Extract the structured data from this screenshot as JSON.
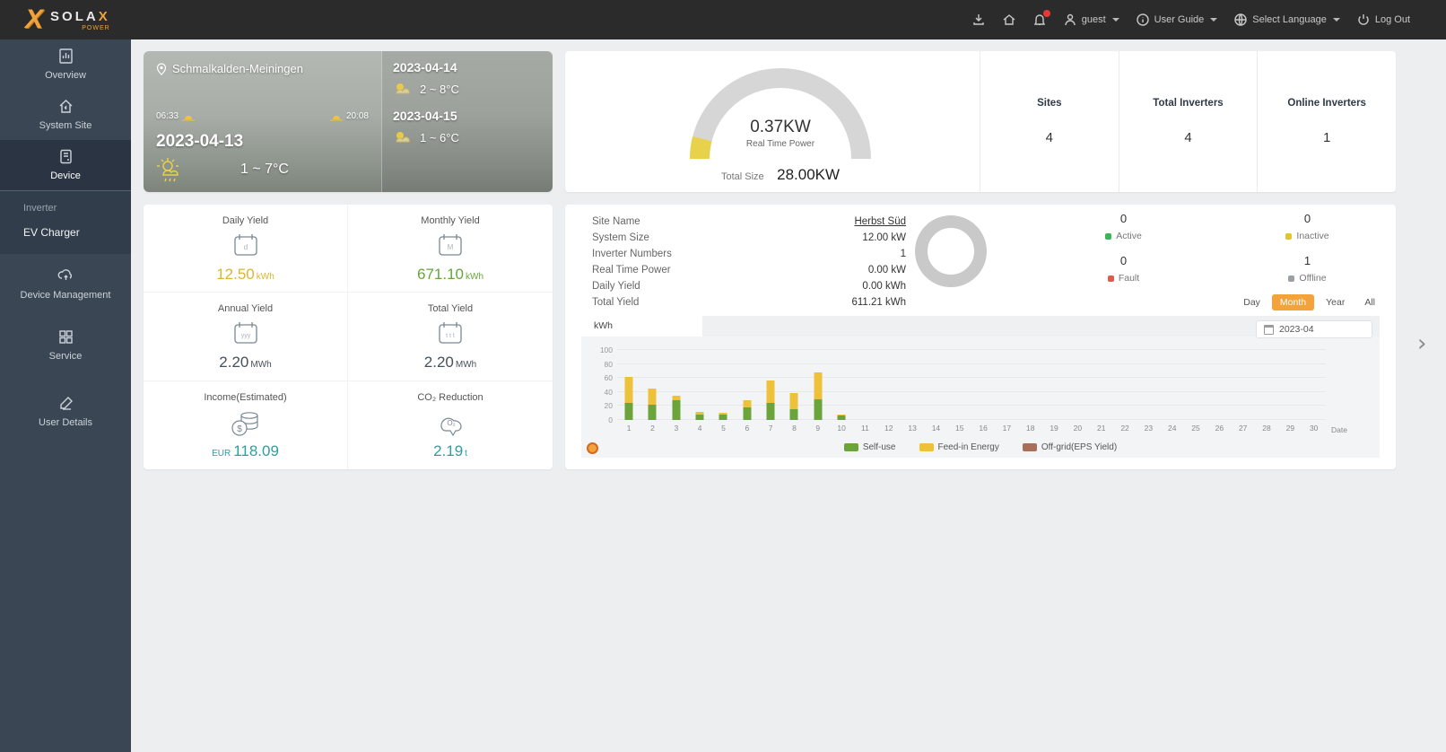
{
  "navbar": {
    "brand": "SOLA",
    "brand_x": "X",
    "brand_sub": "POWER",
    "user": "guest",
    "user_guide": "User Guide",
    "select_language": "Select Language",
    "log_out": "Log Out"
  },
  "sidebar": {
    "items": [
      {
        "label": "Overview"
      },
      {
        "label": "System Site"
      },
      {
        "label": "Device"
      },
      {
        "label": "Device Management"
      },
      {
        "label": "Service"
      },
      {
        "label": "User Details"
      }
    ],
    "device_submenu": [
      {
        "label": "Inverter"
      },
      {
        "label": "EV Charger"
      }
    ]
  },
  "weather": {
    "location": "Schmalkalden-Meiningen",
    "sunrise": "06:33",
    "sunset": "20:08",
    "today": {
      "date": "2023-04-13",
      "temp": "1 ~ 7°C"
    },
    "forecast": [
      {
        "date": "2023-04-14",
        "temp": "2 ~ 8°C"
      },
      {
        "date": "2023-04-15",
        "temp": "1 ~ 6°C"
      }
    ]
  },
  "overview": {
    "power_value": "0.37KW",
    "power_label": "Real Time Power",
    "total_size_label": "Total Size",
    "total_size_value": "28.00KW",
    "gauge": {
      "ratio": 0.08,
      "track_color": "#d6d6d6",
      "fill_color": "#e8d14b"
    },
    "stats": [
      {
        "label": "Sites",
        "value": "4"
      },
      {
        "label": "Total Inverters",
        "value": "4"
      },
      {
        "label": "Online Inverters",
        "value": "1"
      }
    ]
  },
  "yield_card": {
    "tiles": [
      {
        "label": "Daily Yield",
        "prefix": "",
        "value": "12.50",
        "unit": "kWh",
        "color": "#d9b62f"
      },
      {
        "label": "Monthly Yield",
        "prefix": "",
        "value": "671.10",
        "unit": "kWh",
        "color": "#67a43a"
      },
      {
        "label": "Annual Yield",
        "prefix": "",
        "value": "2.20",
        "unit": "MWh",
        "color": "#46505a"
      },
      {
        "label": "Total Yield",
        "prefix": "",
        "value": "2.20",
        "unit": "MWh",
        "color": "#46505a"
      },
      {
        "label": "Income(Estimated)",
        "prefix": "EUR",
        "value": "118.09",
        "unit": "",
        "color": "#2f9e9e"
      },
      {
        "label": "CO₂ Reduction",
        "prefix": "",
        "value": "2.19",
        "unit": "t",
        "color": "#2f9e9e"
      }
    ]
  },
  "site_panel": {
    "rows": [
      {
        "label": "Site Name",
        "value": "Herbst Süd"
      },
      {
        "label": "System Size",
        "value": "12.00 kW"
      },
      {
        "label": "Inverter Numbers",
        "value": "1"
      },
      {
        "label": "Real Time Power",
        "value": "0.00 kW"
      },
      {
        "label": "Daily Yield",
        "value": "0.00 kWh"
      },
      {
        "label": "Total Yield",
        "value": "611.21 kWh"
      }
    ],
    "donut_color": "#c9c9c9",
    "statuses": [
      {
        "label": "Active",
        "value": "0",
        "color": "#3cb45a"
      },
      {
        "label": "Inactive",
        "value": "0",
        "color": "#e0c431"
      },
      {
        "label": "Fault",
        "value": "0",
        "color": "#e05a4e"
      },
      {
        "label": "Offline",
        "value": "1",
        "color": "#9aa0a6"
      }
    ],
    "periods": [
      {
        "label": "Day",
        "active": false
      },
      {
        "label": "Month",
        "active": true
      },
      {
        "label": "Year",
        "active": false
      },
      {
        "label": "All",
        "active": false
      }
    ],
    "unit_tab": "kWh",
    "date_value": "2023-04"
  },
  "chart_data": {
    "type": "bar",
    "stacked": true,
    "title": "",
    "xlabel": "Date",
    "ylabel": "kWh",
    "ylim": [
      0,
      100
    ],
    "yticks": [
      0,
      20,
      40,
      60,
      80,
      100
    ],
    "grid": true,
    "legend_position": "bottom",
    "categories": [
      1,
      2,
      3,
      4,
      5,
      6,
      7,
      8,
      9,
      10,
      11,
      12,
      13,
      14,
      15,
      16,
      17,
      18,
      19,
      20,
      21,
      22,
      23,
      24,
      25,
      26,
      27,
      28,
      29,
      30
    ],
    "series": [
      {
        "name": "Self-use",
        "color": "#6ba43a",
        "values": [
          25,
          22,
          28,
          8,
          8,
          18,
          25,
          15,
          30,
          7,
          0,
          0,
          0,
          0,
          0,
          0,
          0,
          0,
          0,
          0,
          0,
          0,
          0,
          0,
          0,
          0,
          0,
          0,
          0,
          0
        ]
      },
      {
        "name": "Feed-in Energy",
        "color": "#edc23a",
        "values": [
          37,
          23,
          7,
          3,
          2,
          10,
          32,
          23,
          38,
          1,
          0,
          0,
          0,
          0,
          0,
          0,
          0,
          0,
          0,
          0,
          0,
          0,
          0,
          0,
          0,
          0,
          0,
          0,
          0,
          0
        ]
      },
      {
        "name": "Off-grid(EPS Yield)",
        "color": "#a8705a",
        "values": [
          0,
          0,
          0,
          0,
          0,
          0,
          0,
          0,
          0,
          0,
          0,
          0,
          0,
          0,
          0,
          0,
          0,
          0,
          0,
          0,
          0,
          0,
          0,
          0,
          0,
          0,
          0,
          0,
          0,
          0
        ]
      }
    ]
  },
  "icons": {
    "chevron_down": "▾",
    "next_chevron": "›",
    "sun": "☀"
  }
}
